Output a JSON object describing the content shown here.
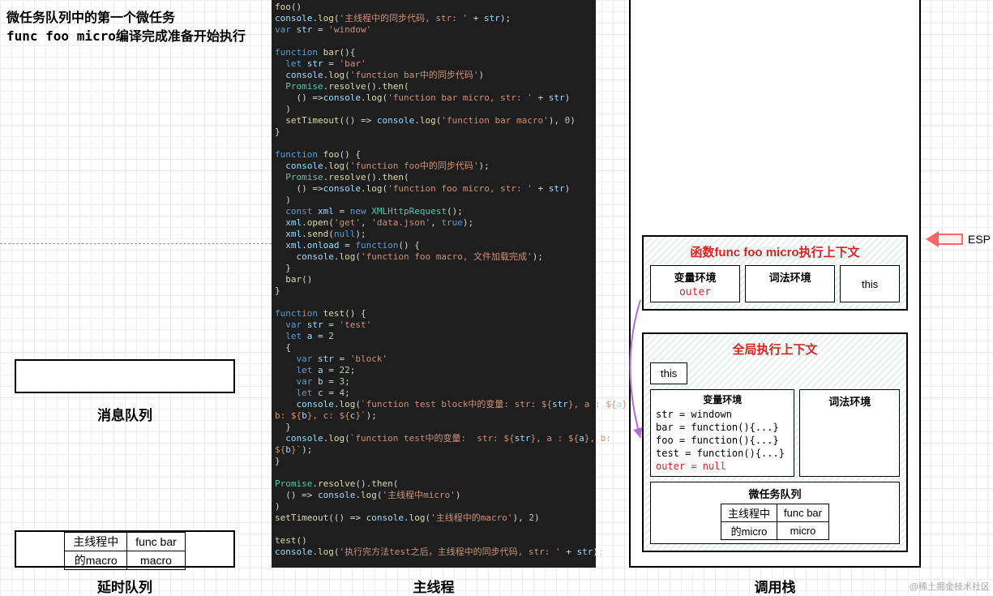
{
  "heading": {
    "line1": "微任务队列中的第一个微任务",
    "line2": "func foo micro编译完成准备开始执行"
  },
  "message_queue": {
    "label": "消息队列"
  },
  "delay_queue": {
    "label": "延时队列",
    "cells": {
      "r0c0": "主线程中",
      "r0c1": "func bar",
      "r1c0": "的macro",
      "r1c1": "macro"
    }
  },
  "main_thread": {
    "label": "主线程"
  },
  "call_stack": {
    "label": "调用栈"
  },
  "esp_label": "ESP",
  "func_ctx": {
    "title": "函数func foo micro执行上下文",
    "var_env_label": "变量环境",
    "lex_env_label": "词法环境",
    "outer": "outer",
    "this": "this"
  },
  "global_ctx": {
    "title": "全局执行上下文",
    "this": "this",
    "var_env_label": "变量环境",
    "lex_env_label": "词法环境",
    "var_env_body": "str = windown\nbar = function(){...}\nfoo = function(){...}\ntest = function(){...}",
    "outer_line": "outer = null",
    "micro_queue_label": "微任务队列",
    "micro_cells": {
      "r0c0": "主线程中",
      "r0c1": "func bar",
      "r1c0": "的micro",
      "r1c1": "micro"
    }
  },
  "watermark": "@稀土掘金技术社区",
  "code_html": "<span class='f'>foo</span>()\n<span class='v'>console</span>.<span class='f'>log</span>(<span class='s'>'主线程中的同步代码, str: '</span> + <span class='v'>str</span>);\n<span class='k'>var</span> <span class='v'>str</span> = <span class='s'>'window'</span>\n\n<span class='k'>function</span> <span class='f'>bar</span>(){\n  <span class='k'>let</span> <span class='v'>str</span> = <span class='s'>'bar'</span>\n  <span class='v'>console</span>.<span class='f'>log</span>(<span class='s'>'function bar中的同步代码'</span>)\n  <span class='c'>Promise</span>.<span class='f'>resolve</span>().<span class='f'>then</span>(\n    () =&gt;<span class='v'>console</span>.<span class='f'>log</span>(<span class='s'>'function bar micro, str: '</span> + <span class='v'>str</span>)\n  )\n  <span class='f'>setTimeout</span>(() =&gt; <span class='v'>console</span>.<span class='f'>log</span>(<span class='s'>'function bar macro'</span>), <span class='n'>0</span>)\n}\n\n<span class='k'>function</span> <span class='f'>foo</span>() {\n  <span class='v'>console</span>.<span class='f'>log</span>(<span class='s'>'function foo中的同步代码'</span>);\n  <span class='c'>Promise</span>.<span class='f'>resolve</span>().<span class='f'>then</span>(\n    () =&gt;<span class='v'>console</span>.<span class='f'>log</span>(<span class='s'>'function foo micro, str: '</span> + <span class='v'>str</span>)\n  )\n  <span class='k'>const</span> <span class='v'>xml</span> = <span class='k'>new</span> <span class='c'>XMLHttpRequest</span>();\n  <span class='v'>xml</span>.<span class='f'>open</span>(<span class='s'>'get'</span>, <span class='s'>'data.json'</span>, <span class='k'>true</span>);\n  <span class='v'>xml</span>.<span class='f'>send</span>(<span class='k'>null</span>);\n  <span class='v'>xml</span>.<span class='v'>onload</span> = <span class='k'>function</span>() {\n    <span class='v'>console</span>.<span class='f'>log</span>(<span class='s'>'function foo macro, 文件加载完成'</span>);\n  }\n  <span class='f'>bar</span>()\n}\n\n<span class='k'>function</span> <span class='f'>test</span>() {\n  <span class='k'>var</span> <span class='v'>str</span> = <span class='s'>'test'</span>\n  <span class='k'>let</span> <span class='v'>a</span> = <span class='n'>2</span>\n  {\n    <span class='k'>var</span> <span class='v'>str</span> = <span class='s'>'block'</span>\n    <span class='k'>let</span> <span class='v'>a</span> = <span class='n'>22</span>;\n    <span class='k'>var</span> <span class='v'>b</span> = <span class='n'>3</span>;\n    <span class='k'>let</span> <span class='v'>c</span> = <span class='n'>4</span>;\n    <span class='v'>console</span>.<span class='f'>log</span>(<span class='s'>`function test block中的变量: str: ${</span><span class='v'>str</span><span class='s'>}, a : ${</span><span class='v'>a</span><span class='s'>},\nb: ${</span><span class='v'>b</span><span class='s'>}, c: ${</span><span class='v'>c</span><span class='s'>}`</span>);\n  }\n  <span class='v'>console</span>.<span class='f'>log</span>(<span class='s'>`function test中的变量:  str: ${</span><span class='v'>str</span><span class='s'>}, a : ${</span><span class='v'>a</span><span class='s'>}, b:\n${</span><span class='v'>b</span><span class='s'>}`</span>);\n}\n\n<span class='c'>Promise</span>.<span class='f'>resolve</span>().<span class='f'>then</span>(\n  () =&gt; <span class='v'>console</span>.<span class='f'>log</span>(<span class='s'>'主线程中micro'</span>)\n)\n<span class='f'>setTimeout</span>(() =&gt; <span class='v'>console</span>.<span class='f'>log</span>(<span class='s'>'主线程中的macro'</span>), <span class='n'>2</span>)\n\n<span class='f'>test</span>()\n<span class='v'>console</span>.<span class='f'>log</span>(<span class='s'>'执行完方法test之后，主线程中的同步代码, str: '</span> + <span class='v'>str</span>);"
}
